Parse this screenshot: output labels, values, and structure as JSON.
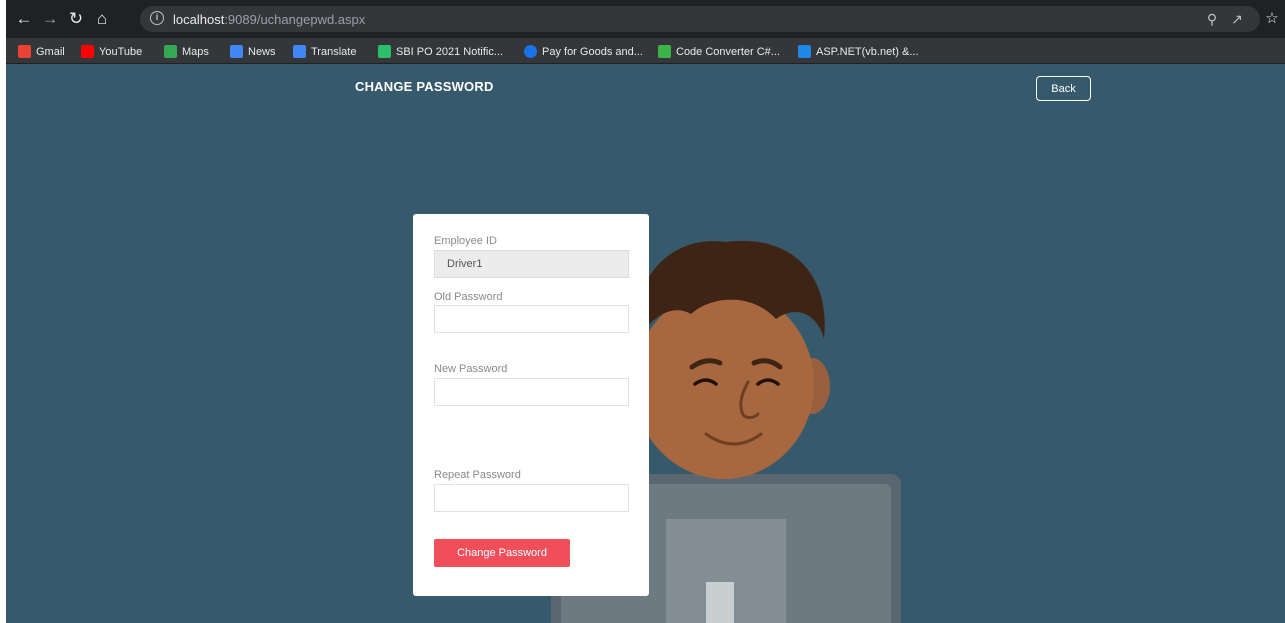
{
  "browser": {
    "url_host": "localhost",
    "url_path": ":9089/uchangepwd.aspx",
    "bookmarks": [
      {
        "label": "Gmail",
        "color": "#ea4335"
      },
      {
        "label": "YouTube",
        "color": "#ff0000"
      },
      {
        "label": "Maps",
        "color": "#34a853"
      },
      {
        "label": "News",
        "color": "#4285f4"
      },
      {
        "label": "Translate",
        "color": "#4285f4"
      },
      {
        "label": "SBI PO 2021 Notific...",
        "color": "#2bbf6a"
      },
      {
        "label": "Pay for Goods and...",
        "color": "#1a73e8"
      },
      {
        "label": "Code Converter C#...",
        "color": "#3bb54a"
      },
      {
        "label": "ASP.NET(vb.net) &...",
        "color": "#1e88e5"
      }
    ]
  },
  "page": {
    "title": "CHANGE PASSWORD",
    "back_label": "Back",
    "background_color": "#365a6b",
    "accent_color": "#f04e5a"
  },
  "form": {
    "employee_id_label": "Employee ID",
    "employee_id_value": "Driver1",
    "old_password_label": "Old Password",
    "new_password_label": "New Password",
    "repeat_password_label": "Repeat Password",
    "submit_label": "Change Password"
  }
}
